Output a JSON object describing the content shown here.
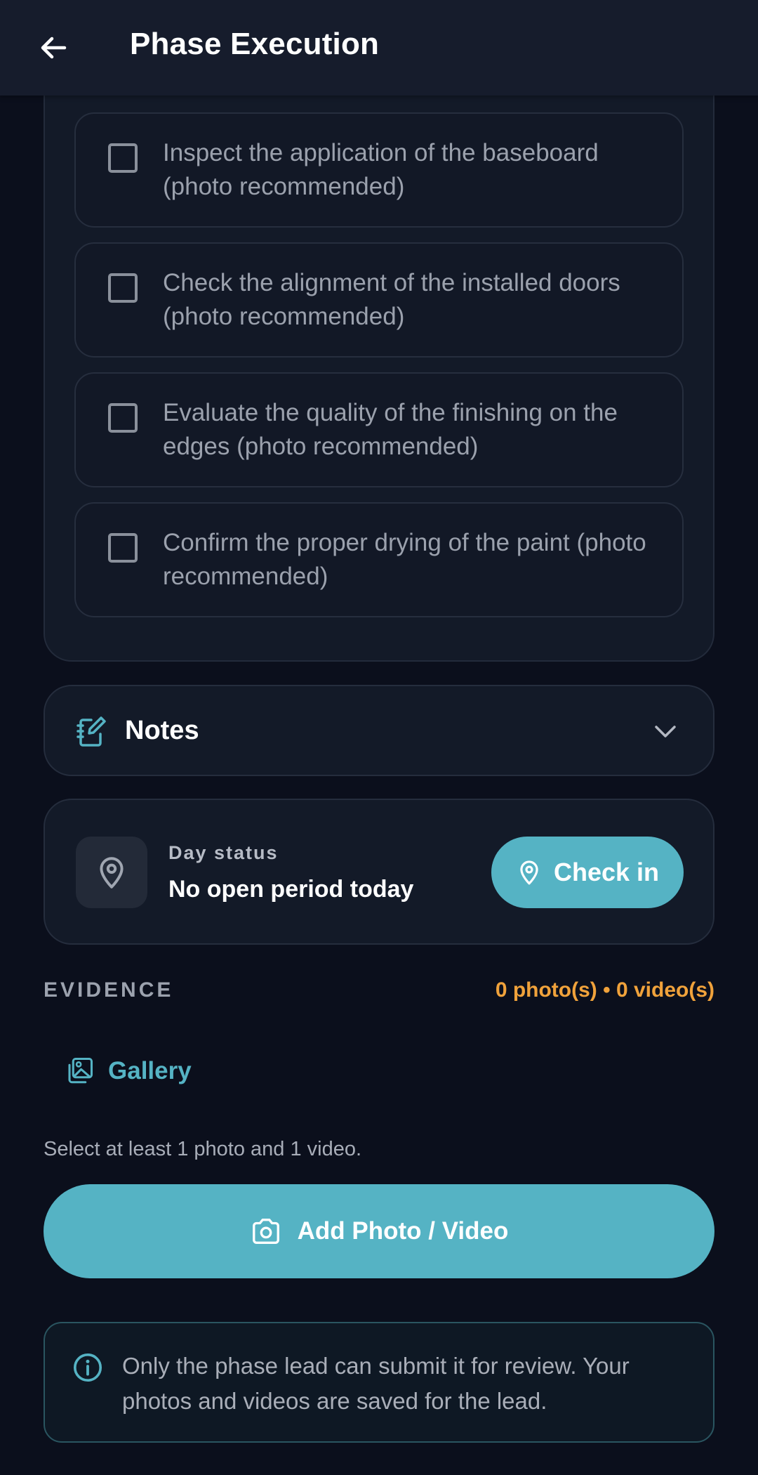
{
  "appbar": {
    "title": "Phase Execution",
    "back_icon": "arrow-left-icon"
  },
  "checklist": {
    "items": [
      {
        "label": "Inspect the application of the baseboard (photo recommended)",
        "checked": false
      },
      {
        "label": "Check the alignment of the installed doors (photo recommended)",
        "checked": false
      },
      {
        "label": "Evaluate the quality of the finishing on the edges (photo recommended)",
        "checked": false
      },
      {
        "label": "Confirm the proper drying of the paint (photo recommended)",
        "checked": false
      }
    ]
  },
  "notes": {
    "label": "Notes",
    "icon": "notebook-edit-icon",
    "expand_icon": "chevron-down-icon"
  },
  "day_status": {
    "caption": "Day status",
    "value": "No open period today",
    "icon": "map-pin-icon",
    "checkin_label": "Check in"
  },
  "evidence": {
    "title": "EVIDENCE",
    "count": "0 photo(s) • 0 video(s)",
    "gallery_label": "Gallery",
    "hint": "Select at least 1 photo and 1 video.",
    "add_label": "Add Photo / Video"
  },
  "info": {
    "text": "Only the phase lead can submit it for review. Your photos and videos are saved for the lead."
  },
  "colors": {
    "accent": "#55b3c4",
    "warning": "#f0a23b",
    "background": "#0b0f1c",
    "card": "#131a28"
  }
}
